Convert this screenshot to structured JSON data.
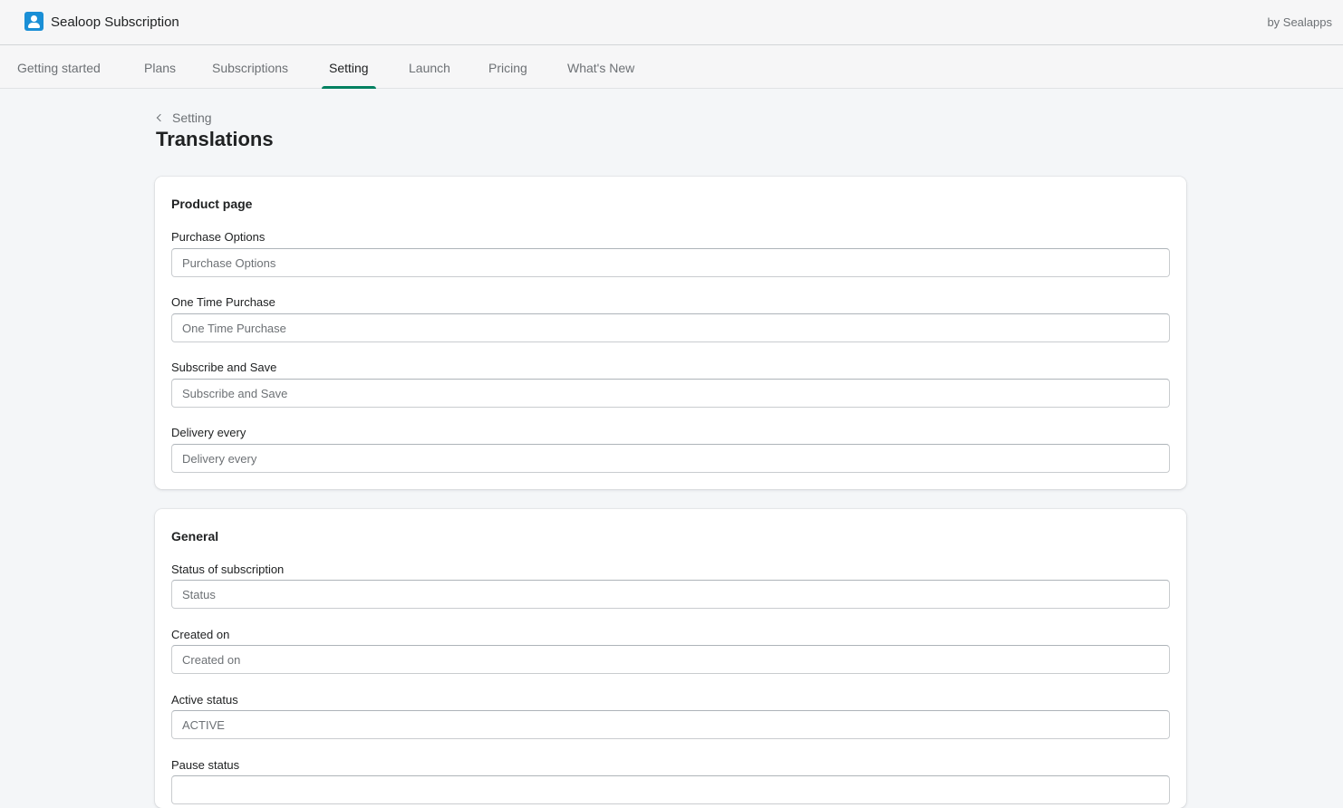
{
  "app": {
    "title": "Sealoop Subscription",
    "vendor": "by Sealapps",
    "logo_icon": "user-icon",
    "accent_color": "#008060",
    "logo_color": "#1a8fd6"
  },
  "nav": {
    "tabs": [
      {
        "label": "Getting started",
        "active": false
      },
      {
        "label": "Plans",
        "active": false
      },
      {
        "label": "Subscriptions",
        "active": false
      },
      {
        "label": "Setting",
        "active": true
      },
      {
        "label": "Launch",
        "active": false
      },
      {
        "label": "Pricing",
        "active": false
      },
      {
        "label": "What's New",
        "active": false
      }
    ]
  },
  "page": {
    "breadcrumb": "Setting",
    "title": "Translations"
  },
  "product_card": {
    "title": "Product page",
    "fields": [
      {
        "label": "Purchase Options",
        "value": "",
        "placeholder": "Purchase Options"
      },
      {
        "label": "One Time Purchase",
        "value": "",
        "placeholder": "One Time Purchase"
      },
      {
        "label": "Subscribe and Save",
        "value": "",
        "placeholder": "Subscribe and Save"
      },
      {
        "label": "Delivery every",
        "value": "",
        "placeholder": "Delivery every"
      }
    ]
  },
  "general_card": {
    "title": "General",
    "fields": [
      {
        "label": "Status of subscription",
        "value": "",
        "placeholder": "Status"
      },
      {
        "label": "Created on",
        "value": "",
        "placeholder": "Created on"
      },
      {
        "label": "Active status",
        "value": "",
        "placeholder": "ACTIVE"
      },
      {
        "label": "Pause status",
        "value": "",
        "placeholder": ""
      }
    ]
  }
}
